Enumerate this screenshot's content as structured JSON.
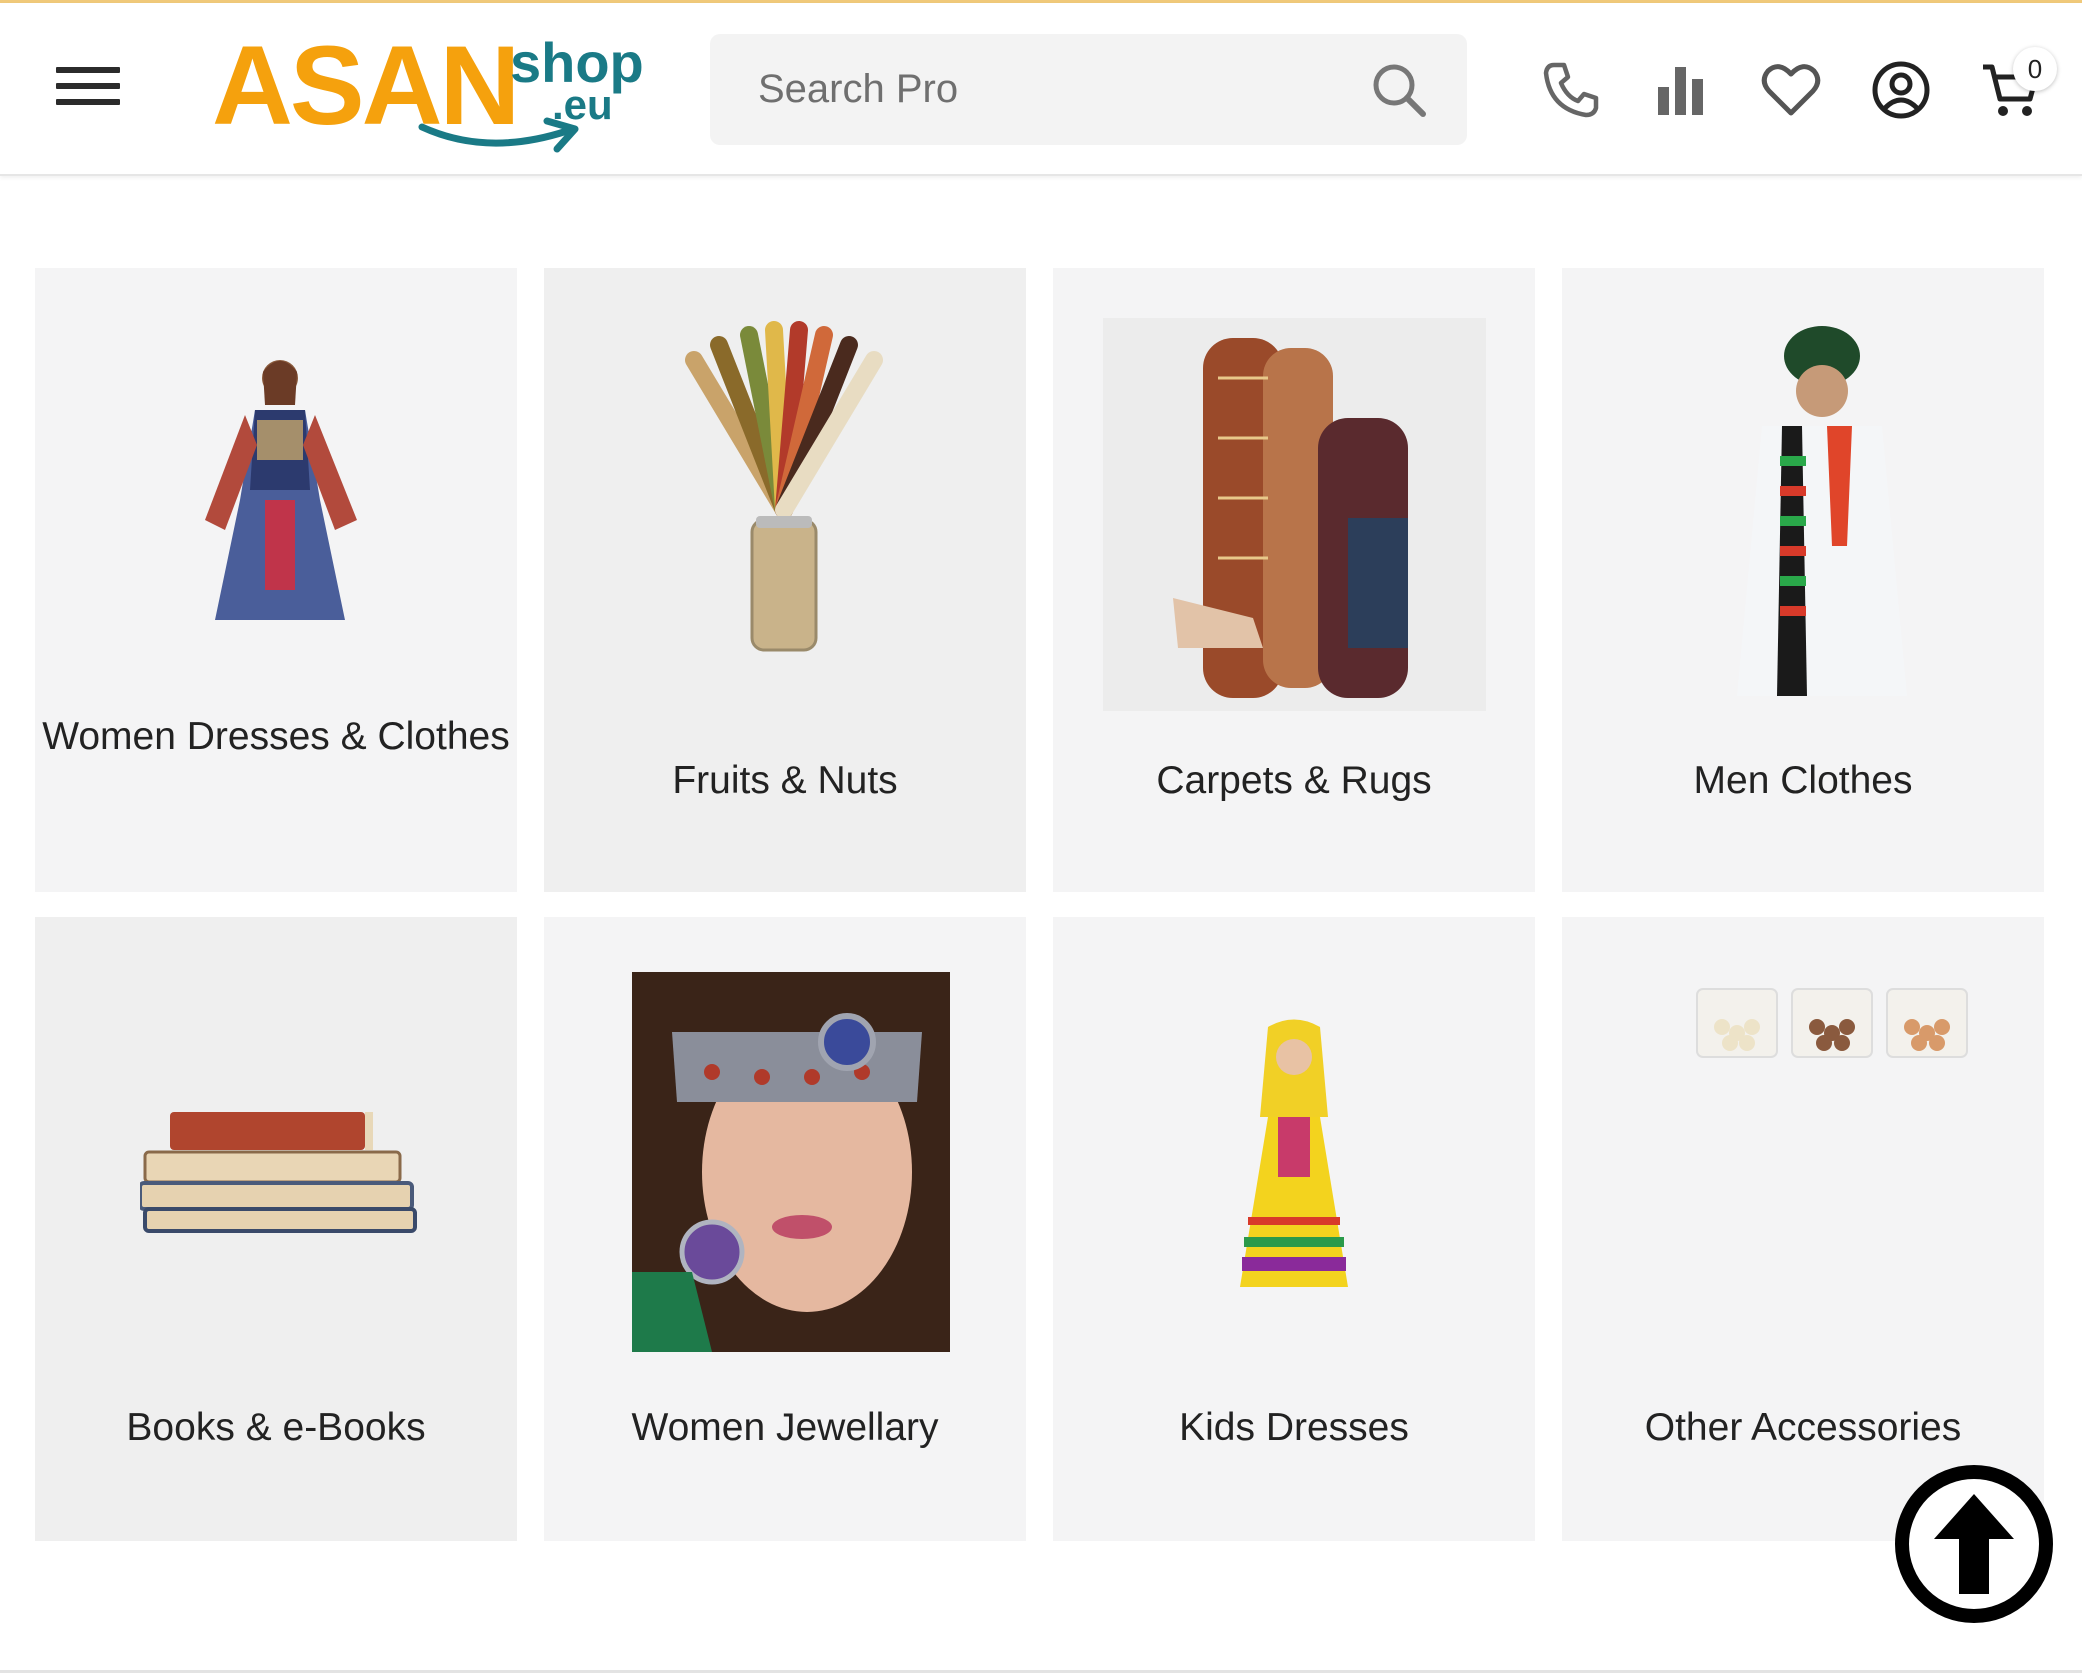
{
  "header": {
    "logo": {
      "main": "ASAN",
      "shop": "shop",
      "domain": ".eu"
    },
    "search": {
      "placeholder": "Search Pro"
    },
    "icons": [
      "menu-icon",
      "search-icon",
      "phone-icon",
      "compare-chart-icon",
      "heart-icon",
      "account-icon",
      "cart-icon"
    ],
    "cart_count": "0"
  },
  "categories": [
    {
      "label": "Women Dresses & Clothes",
      "image": "woman-dress-image"
    },
    {
      "label": "Fruits & Nuts",
      "image": "dried-fruits-jar-image"
    },
    {
      "label": "Carpets & Rugs",
      "image": "rolled-carpets-image"
    },
    {
      "label": "Men Clothes",
      "image": "man-traditional-clothes-image"
    },
    {
      "label": "Books & e-Books",
      "image": "book-stack-image"
    },
    {
      "label": "Women Jewellary",
      "image": "woman-headpiece-image"
    },
    {
      "label": "Kids Dresses",
      "image": "girl-yellow-dress-image"
    },
    {
      "label": "Other Accessories",
      "image": "snack-pouches-image"
    }
  ],
  "colors": {
    "brand_orange": "#f5a10d",
    "brand_teal": "#1a7a86",
    "card_bg": "#f4f4f5"
  },
  "back_to_top": "arrow-up-circle-icon"
}
